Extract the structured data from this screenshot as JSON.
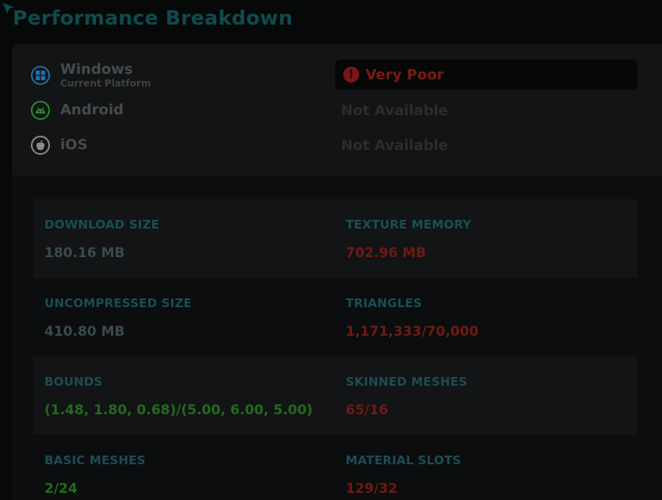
{
  "page_title": "Performance Breakdown",
  "colors": {
    "title": "#0f4a4e",
    "label": "#1c4c56",
    "good": "#236a1c",
    "bad": "#6e1a14",
    "neutral": "#3a4a4d",
    "windows_icon": "#1e6fa8",
    "android_icon": "#2a8a2a",
    "ios_icon": "#8a8a8a"
  },
  "platforms": [
    {
      "name": "Windows",
      "subtitle": "Current Platform",
      "icon": "windows-icon",
      "status": "Very Poor",
      "status_icon": "exclamation-icon"
    },
    {
      "name": "Android",
      "subtitle": "",
      "icon": "android-icon",
      "status": "Not Available"
    },
    {
      "name": "iOS",
      "subtitle": "",
      "icon": "apple-icon",
      "status": "Not Available"
    }
  ],
  "stats": [
    {
      "label": "DOWNLOAD SIZE",
      "value": "180.16 MB",
      "state": "neutral"
    },
    {
      "label": "TEXTURE MEMORY",
      "value": "702.96 MB",
      "state": "bad"
    },
    {
      "label": "UNCOMPRESSED SIZE",
      "value": "410.80 MB",
      "state": "neutral"
    },
    {
      "label": "TRIANGLES",
      "value": "1,171,333/70,000",
      "state": "bad"
    },
    {
      "label": "BOUNDS",
      "value": "(1.48, 1.80, 0.68)/(5.00, 6.00, 5.00)",
      "state": "good"
    },
    {
      "label": "SKINNED MESHES",
      "value": "65/16",
      "state": "bad"
    },
    {
      "label": "BASIC MESHES",
      "value": "2/24",
      "state": "good"
    },
    {
      "label": "MATERIAL SLOTS",
      "value": "129/32",
      "state": "bad"
    }
  ]
}
